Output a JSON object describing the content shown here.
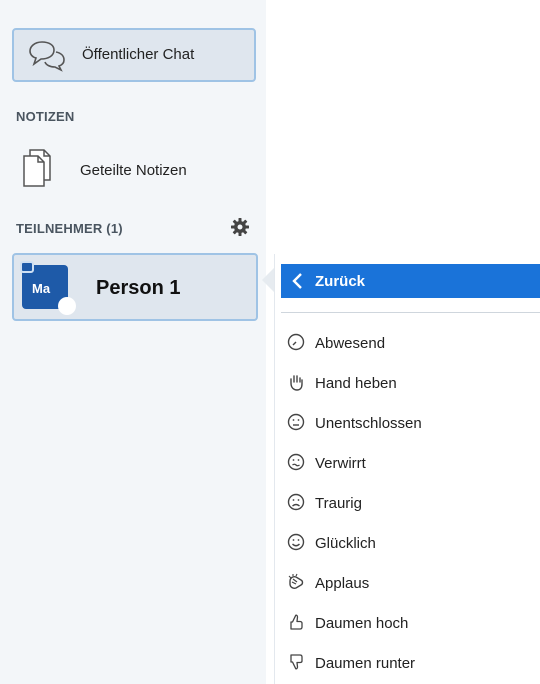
{
  "sidebar": {
    "public_chat": {
      "label": "Öffentlicher Chat",
      "icon": "chat-bubbles-icon"
    },
    "notes_section": {
      "title": "NOTIZEN"
    },
    "shared_notes": {
      "label": "Geteilte Notizen",
      "icon": "documents-icon"
    },
    "participants_section": {
      "title": "TEILNEHMER (1)",
      "settings_icon": "gear-icon"
    },
    "user": {
      "initials": "Ma",
      "name": "Person 1",
      "avatar_color": "#1e5aa8"
    }
  },
  "status_menu": {
    "back": {
      "label": "Zurück",
      "icon": "chevron-left-icon",
      "color": "#1a73d9"
    },
    "items": [
      {
        "label": "Abwesend",
        "icon": "clock-icon"
      },
      {
        "label": "Hand heben",
        "icon": "raised-hand-icon"
      },
      {
        "label": "Unentschlossen",
        "icon": "neutral-face-icon"
      },
      {
        "label": "Verwirrt",
        "icon": "confused-face-icon"
      },
      {
        "label": "Traurig",
        "icon": "sad-face-icon"
      },
      {
        "label": "Glücklich",
        "icon": "happy-face-icon"
      },
      {
        "label": "Applaus",
        "icon": "clapping-hands-icon"
      },
      {
        "label": "Daumen hoch",
        "icon": "thumbs-up-icon"
      },
      {
        "label": "Daumen runter",
        "icon": "thumbs-down-icon"
      }
    ]
  }
}
